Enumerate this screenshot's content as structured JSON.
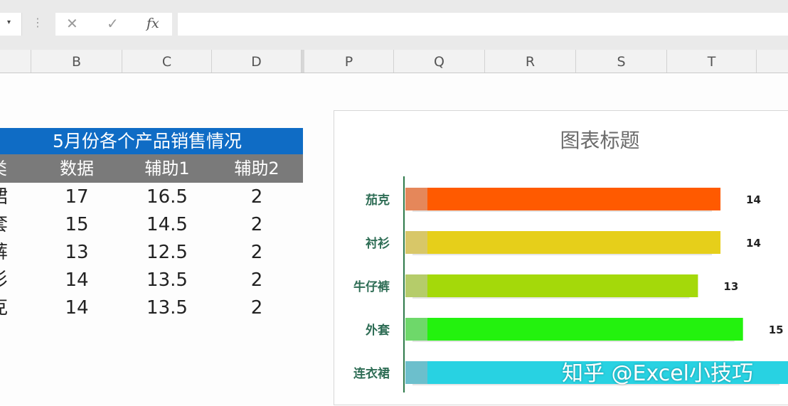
{
  "formula_bar": {
    "fx_label": "fx",
    "cancel_icon": "close-icon",
    "confirm_icon": "check-icon",
    "value": ""
  },
  "columns": [
    "B",
    "C",
    "D",
    "P",
    "Q",
    "R",
    "S",
    "T"
  ],
  "table": {
    "title": "5月份各个产品销售情况",
    "headers": [
      "类",
      "数据",
      "辅助1",
      "辅助2"
    ],
    "rows": [
      [
        "裙",
        "17",
        "16.5",
        "2"
      ],
      [
        "套",
        "15",
        "14.5",
        "2"
      ],
      [
        "裤",
        "13",
        "12.5",
        "2"
      ],
      [
        "衫",
        "14",
        "13.5",
        "2"
      ],
      [
        "克",
        "14",
        "13.5",
        "2"
      ]
    ]
  },
  "chart_data": {
    "type": "bar",
    "orientation": "horizontal",
    "title": "图表标题",
    "categories": [
      "茄克",
      "衬衫",
      "牛仔裤",
      "外套",
      "连衣裙"
    ],
    "values": [
      14,
      14,
      13,
      15,
      17
    ],
    "data_labels": [
      "14",
      "14",
      "13",
      "15",
      ""
    ],
    "colors": [
      "#ff5a00",
      "#e6cf1a",
      "#a4d90a",
      "#23f20e",
      "#28d2e2"
    ],
    "accent_colors": [
      "#e5875a",
      "#d8c768",
      "#b5cc6a",
      "#6ed86a",
      "#6cbfcc"
    ],
    "xlim": [
      0,
      17
    ],
    "legend": "none",
    "grid": false
  },
  "watermark": "知乎 @Excel小技巧"
}
